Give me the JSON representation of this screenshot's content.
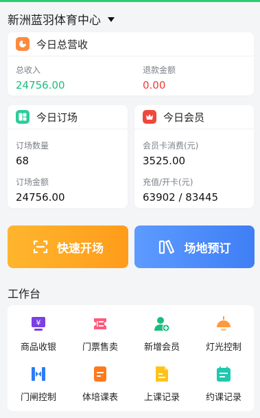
{
  "header": {
    "venue_name": "新洲蓝羽体育中心"
  },
  "revenue": {
    "title": "今日总营收",
    "total_label": "总收入",
    "total_value": "24756.00",
    "refund_label": "退款金额",
    "refund_value": "0.00"
  },
  "booking": {
    "title": "今日订场",
    "count_label": "订场数量",
    "count_value": "68",
    "amount_label": "订场金额",
    "amount_value": "24756.00"
  },
  "member": {
    "title": "今日会员",
    "consume_label": "会员卡消费(元)",
    "consume_value": "3525.00",
    "recharge_label": "充值/开卡(元)",
    "recharge_value": "63902 / 83445"
  },
  "actions": {
    "quick_open": "快速开场",
    "venue_booking": "场地预订"
  },
  "workbench": {
    "title": "工作台",
    "items": [
      {
        "label": "商品收银",
        "icon": "cashier-icon",
        "color": "#7b3fe4"
      },
      {
        "label": "门票售卖",
        "icon": "ticket-icon",
        "color": "#ff5a7a"
      },
      {
        "label": "新增会员",
        "icon": "add-member-icon",
        "color": "#1bbd7f"
      },
      {
        "label": "灯光控制",
        "icon": "lamp-icon",
        "color": "#ff9a3c"
      },
      {
        "label": "门闸控制",
        "icon": "gate-icon",
        "color": "#2f7bf5"
      },
      {
        "label": "体培课表",
        "icon": "schedule-icon",
        "color": "#ff7a1a"
      },
      {
        "label": "上课记录",
        "icon": "class-record-icon",
        "color": "#ffc21a"
      },
      {
        "label": "约课记录",
        "icon": "booking-record-icon",
        "color": "#1ec9b0"
      }
    ]
  }
}
